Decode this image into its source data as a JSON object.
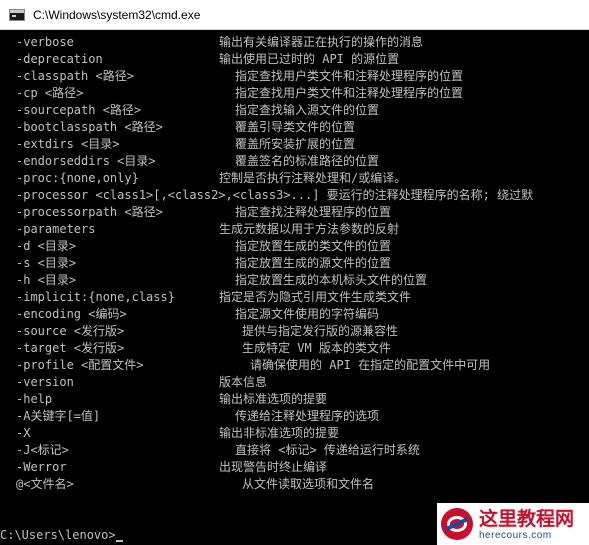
{
  "window": {
    "title": "C:\\Windows\\system32\\cmd.exe",
    "icon": "console-window-icon"
  },
  "console": {
    "rows": [
      {
        "opt": "-verbose",
        "desc": "输出有关编译器正在执行的操作的消息"
      },
      {
        "opt": "-deprecation",
        "desc": "输出使用已过时的 API 的源位置"
      },
      {
        "opt": "-classpath <路径>",
        "desc": "指定查找用户类文件和注释处理程序的位置"
      },
      {
        "opt": "-cp <路径>",
        "desc": "指定查找用户类文件和注释处理程序的位置"
      },
      {
        "opt": "-sourcepath <路径>",
        "desc": "指定查找输入源文件的位置"
      },
      {
        "opt": "-bootclasspath <路径>",
        "desc": "覆盖引导类文件的位置"
      },
      {
        "opt": "-extdirs <目录>",
        "desc": "覆盖所安装扩展的位置"
      },
      {
        "opt": "-endorseddirs <目录>",
        "desc": "覆盖签名的标准路径的位置"
      },
      {
        "opt": "-proc:{none,only}",
        "desc": "控制是否执行注释处理和/或编译。"
      },
      {
        "opt": "-processor <class1>[,<class2>,<class3>...] 要运行的注释处理程序的名称; 绕过默"
      },
      {
        "opt": "-processorpath <路径>",
        "desc": "指定查找注释处理程序的位置"
      },
      {
        "opt": "-parameters",
        "desc": "生成元数据以用于方法参数的反射"
      },
      {
        "opt": "-d <目录>",
        "desc": "指定放置生成的类文件的位置"
      },
      {
        "opt": "-s <目录>",
        "desc": "指定放置生成的源文件的位置"
      },
      {
        "opt": "-h <目录>",
        "desc": "指定放置生成的本机标头文件的位置"
      },
      {
        "opt": "-implicit:{none,class}",
        "desc": "指定是否为隐式引用文件生成类文件"
      },
      {
        "opt": "-encoding <编码>",
        "desc": "指定源文件使用的字符编码"
      },
      {
        "opt": "-source <发行版>",
        "desc": "提供与指定发行版的源兼容性"
      },
      {
        "opt": "-target <发行版>",
        "desc": "生成特定 VM 版本的类文件"
      },
      {
        "opt": "-profile <配置文件>",
        "desc": "请确保使用的 API 在指定的配置文件中可用"
      },
      {
        "opt": "-version",
        "desc": "版本信息"
      },
      {
        "opt": "-help",
        "desc": "输出标准选项的提要"
      },
      {
        "opt": "-A关键字[=值]",
        "desc": "传递给注释处理程序的选项"
      },
      {
        "opt": "-X",
        "desc": "输出非标准选项的提要"
      },
      {
        "opt": "-J<标记>",
        "desc": "直接将 <标记> 传递给运行时系统"
      },
      {
        "opt": "-Werror",
        "desc": "出现警告时终止编译"
      },
      {
        "opt": "@<文件名>",
        "desc": "从文件读取选项和文件名"
      }
    ],
    "prompt": "C:\\Users\\lenovo>"
  },
  "watermark": {
    "title": "这里教程网",
    "url": "herecours.com",
    "colors": {
      "brand_red": "#c8102e",
      "brand_blue": "#1a4c9c"
    }
  },
  "colors": {
    "console_bg": "#000000",
    "console_text": "#c0c0c0",
    "titlebar_bg": "#ffffff"
  }
}
